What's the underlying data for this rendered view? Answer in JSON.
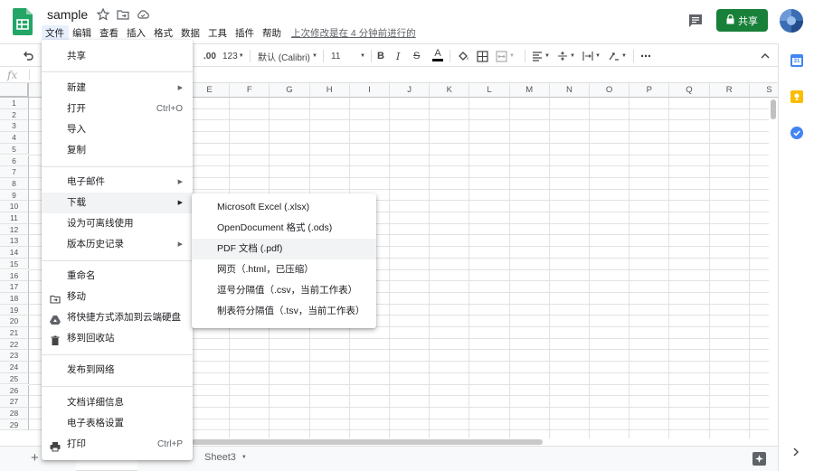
{
  "header": {
    "doc_title": "sample",
    "last_edit": "上次修改是在 4 分钟前进行的",
    "share_label": "共享",
    "menus": [
      "文件",
      "编辑",
      "查看",
      "插入",
      "格式",
      "数据",
      "工具",
      "插件",
      "帮助"
    ]
  },
  "toolbar": {
    "decimal_label": ".00",
    "number_format": "123",
    "font_name": "默认 (Calibri)",
    "font_size": "11"
  },
  "formula_bar": {
    "fx": "fx"
  },
  "grid": {
    "columns": [
      "E",
      "F",
      "G",
      "H",
      "I",
      "J",
      "K",
      "L",
      "M",
      "N",
      "O",
      "P",
      "Q",
      "R",
      "S"
    ],
    "rows": [
      "1",
      "2",
      "3",
      "4",
      "5",
      "6",
      "7",
      "8",
      "9",
      "10",
      "11",
      "12",
      "13",
      "14",
      "15",
      "16",
      "17",
      "18",
      "19",
      "20",
      "21",
      "22",
      "23",
      "24",
      "25",
      "26",
      "27",
      "28",
      "29"
    ]
  },
  "sheets": {
    "tab3": "Sheet3"
  },
  "file_menu": {
    "share": "共享",
    "new": "新建",
    "open": "打开",
    "open_shortcut": "Ctrl+O",
    "import": "导入",
    "copy": "复制",
    "email": "电子邮件",
    "download": "下载",
    "offline": "设为可离线使用",
    "version_history": "版本历史记录",
    "rename": "重命名",
    "move": "移动",
    "add_shortcut": "将快捷方式添加到云端硬盘",
    "trash": "移到回收站",
    "publish": "发布到网络",
    "details": "文档详细信息",
    "settings": "电子表格设置",
    "print": "打印",
    "print_shortcut": "Ctrl+P"
  },
  "download_menu": {
    "xlsx": "Microsoft Excel (.xlsx)",
    "ods": "OpenDocument 格式 (.ods)",
    "pdf": "PDF 文档 (.pdf)",
    "html": "网页（.html，已压缩）",
    "csv": "逗号分隔值（.csv，当前工作表）",
    "tsv": "制表符分隔值（.tsv，当前工作表）"
  },
  "colors": {
    "accent_green": "#188038",
    "sheets_green": "#23a566",
    "menu_hover": "#f1f3f4"
  }
}
